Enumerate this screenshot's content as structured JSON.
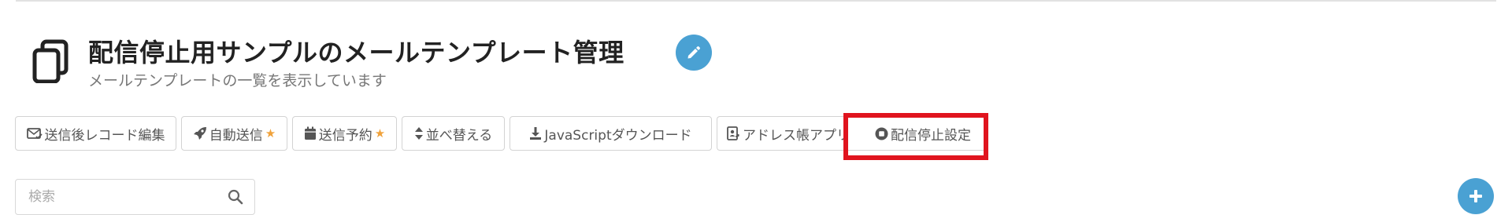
{
  "header": {
    "title": "配信停止用サンプルのメールテンプレート管理",
    "subtitle": "メールテンプレートの一覧を表示しています"
  },
  "toolbar": {
    "buttons": [
      {
        "label": "送信後レコード編集",
        "icon": "envelope-check-icon"
      },
      {
        "label": "自動送信",
        "icon": "rocket-icon",
        "star": "★"
      },
      {
        "label": "送信予約",
        "icon": "calendar-icon",
        "star": "★"
      },
      {
        "label": "並べ替える",
        "icon": "sort-icon"
      },
      {
        "label": "JavaScriptダウンロード",
        "icon": "download-icon"
      },
      {
        "label": "アドレス帳アプリ",
        "icon": "address-book-icon"
      },
      {
        "label": "配信停止設定",
        "icon": "stop-circle-icon"
      }
    ]
  },
  "search": {
    "placeholder": "検索",
    "value": ""
  },
  "colors": {
    "accent": "#4aa1d3",
    "highlight": "#e0141e",
    "star": "#f0a23b"
  }
}
